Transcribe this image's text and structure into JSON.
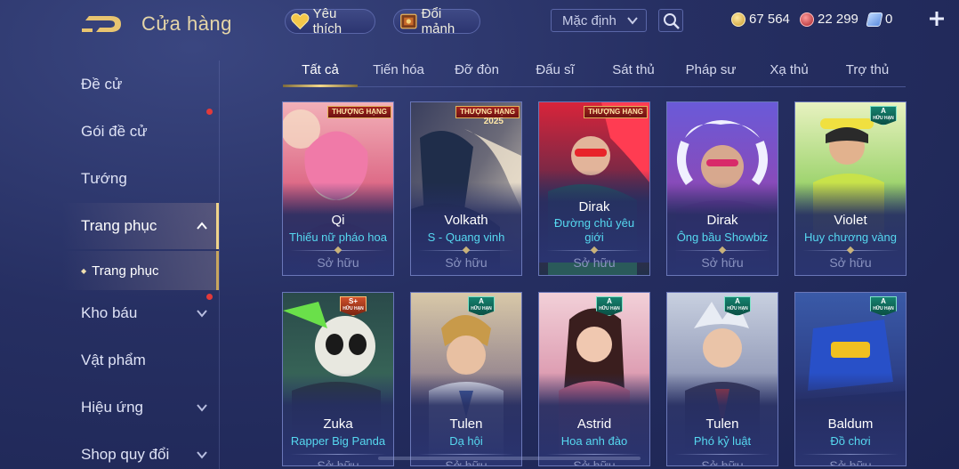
{
  "header": {
    "title": "Cửa hàng",
    "favorites_label": "Yêu thích",
    "fragments_label": "Đổi mảnh",
    "sort_selected": "Mặc định",
    "gold": "67 564",
    "ruby": "22 299",
    "voucher": "0"
  },
  "sidebar": {
    "items": [
      {
        "label": "Đề cử"
      },
      {
        "label": "Gói đề cử"
      },
      {
        "label": "Tướng"
      },
      {
        "label": "Trang phục"
      },
      {
        "label": "Trang phục"
      },
      {
        "label": "Kho báu"
      },
      {
        "label": "Vật phẩm"
      },
      {
        "label": "Hiệu ứng"
      },
      {
        "label": "Shop quy đổi"
      }
    ]
  },
  "tabs": [
    "Tất cả",
    "Tiến hóa",
    "Đỡ đòn",
    "Đấu sĩ",
    "Sát thủ",
    "Pháp sư",
    "Xạ thủ",
    "Trợ thủ"
  ],
  "badges": {
    "ribbon": "THƯỢNG HẠNG",
    "year": "2025",
    "rank_a": "A",
    "rank_splus": "S+",
    "limited": "HỮU HẠN"
  },
  "cards": [
    {
      "hero": "Qi",
      "skin": "Thiếu nữ pháo hoa",
      "status": "Sở hữu"
    },
    {
      "hero": "Volkath",
      "skin": "S - Quang vinh",
      "status": "Sở hữu"
    },
    {
      "hero": "Dirak",
      "skin": "Đường chủ yêu giới",
      "status": "Sở hữu"
    },
    {
      "hero": "Dirak",
      "skin": "Ông bầu Showbiz",
      "status": "Sở hữu"
    },
    {
      "hero": "Violet",
      "skin": "Huy chương vàng",
      "status": "Sở hữu"
    },
    {
      "hero": "Zuka",
      "skin": "Rapper Big Panda",
      "status": "Sở hữu"
    },
    {
      "hero": "Tulen",
      "skin": "Dạ hội",
      "status": "Sở hữu"
    },
    {
      "hero": "Astrid",
      "skin": "Hoa anh đào",
      "status": "Sở hữu"
    },
    {
      "hero": "Tulen",
      "skin": "Phó kỷ luật",
      "status": "Sở hữu"
    },
    {
      "hero": "Baldum",
      "skin": "Đồ chơi",
      "status": "Sở hữu"
    }
  ],
  "colors": {
    "accent_gold": "#f0d48a",
    "skin_name": "#56d8f0",
    "notification": "#e33a3a"
  }
}
